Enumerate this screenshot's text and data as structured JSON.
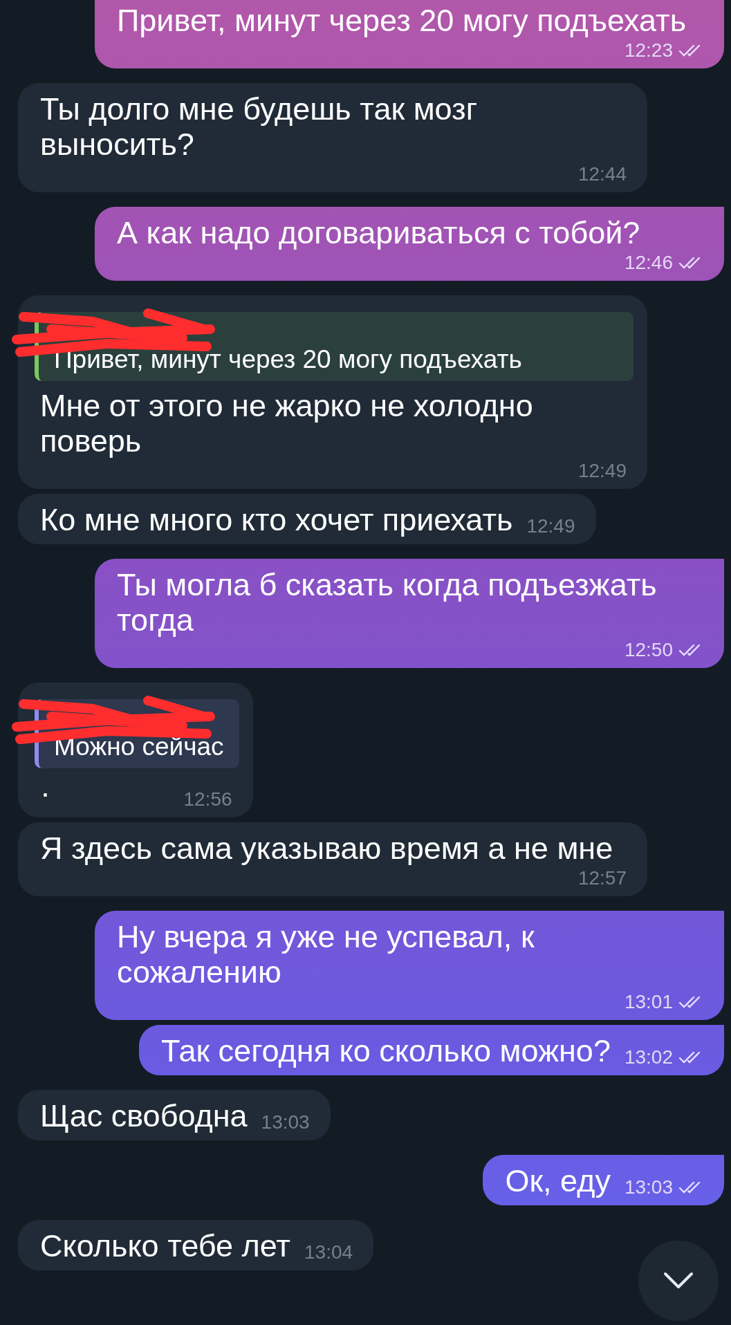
{
  "messages": [
    {
      "kind": "outgoing",
      "text": "Привет, минут через 20 могу подъехать",
      "time": "12:23",
      "read": true
    },
    {
      "kind": "incoming",
      "text": "Ты долго мне будешь так мозг выносить?",
      "time": "12:44"
    },
    {
      "kind": "outgoing",
      "text": "А как надо договариваться с тобой?",
      "time": "12:46",
      "read": true
    },
    {
      "kind": "incoming",
      "quote": {
        "text": "Привет, минут через 20 могу подъехать",
        "color": "#7bc862",
        "author_redacted": true
      },
      "text": "Мне от этого не жарко не холодно поверь",
      "time": "12:49"
    },
    {
      "kind": "incoming",
      "text": "Ко мне много кто хочет приехать",
      "time": "12:49"
    },
    {
      "kind": "outgoing",
      "text": "Ты могла б сказать когда подъезжать тогда",
      "time": "12:50",
      "read": true
    },
    {
      "kind": "incoming",
      "quote": {
        "text": "Можно сейчас",
        "color": "#8c8cf0",
        "author_redacted": true
      },
      "text": "·",
      "time": "12:56"
    },
    {
      "kind": "incoming",
      "text": "Я здесь сама указываю время а не мне",
      "time": "12:57"
    },
    {
      "kind": "outgoing",
      "text": "Ну вчера я уже не успевал, к сожалению",
      "time": "13:01",
      "read": true
    },
    {
      "kind": "outgoing",
      "text": "Так сегодня ко сколько можно?",
      "time": "13:02",
      "read": true
    },
    {
      "kind": "incoming",
      "text": "Щас свободна",
      "time": "13:03"
    },
    {
      "kind": "outgoing",
      "text": "Ок, еду",
      "time": "13:03",
      "read": true
    },
    {
      "kind": "incoming",
      "text": "Сколько тебе лет",
      "time": "13:04"
    }
  ]
}
